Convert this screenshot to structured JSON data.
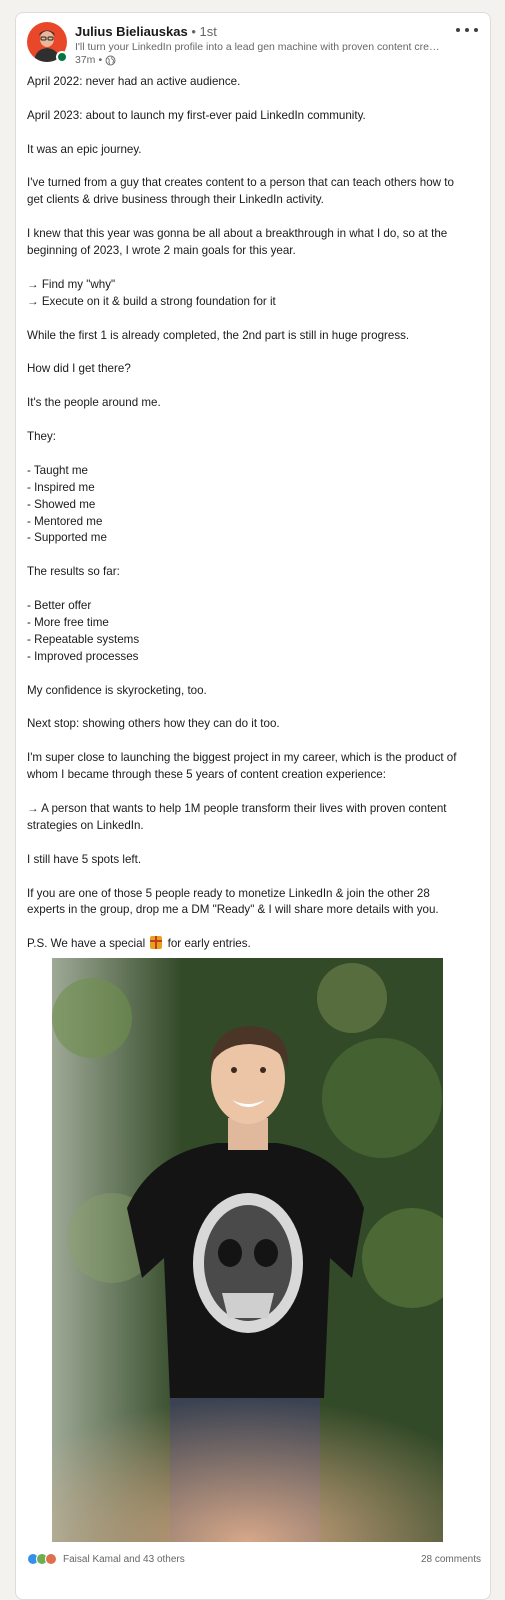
{
  "post": {
    "author": {
      "name": "Julius Bieliauskas",
      "separator": "•",
      "degree": "1st",
      "headline": "I'll turn your LinkedIn profile into a lead gen machine with proven content creati...",
      "time": "37m",
      "time_separator": "•",
      "visibility_icon": "globe-icon"
    },
    "menu_icon": "more-horizontal-icon",
    "body_lines": [
      "April 2022: never had an active audience.",
      "",
      "April 2023: about to launch my first-ever paid LinkedIn community.",
      "",
      "It was an epic journey.",
      "",
      "I've turned from a guy that creates content to a person that can teach others how to",
      "get clients & drive business through their LinkedIn activity.",
      "",
      "I knew that this year was gonna be all about a breakthrough in what I do, so at the",
      "beginning of 2023, I wrote 2 main goals for this year.",
      "",
      "→ Find my \"why\"",
      "→ Execute on it & build a strong foundation for it",
      "",
      "While the first 1 is already completed, the 2nd part is still in huge progress.",
      "",
      "How did I get there?",
      "",
      "It's the people around me.",
      "",
      "They:",
      "",
      "- Taught me",
      "- Inspired me",
      "- Showed me",
      "- Mentored me",
      "- Supported me",
      "",
      "The results so far:",
      "",
      "- Better offer",
      "- More free time",
      "- Repeatable systems",
      "- Improved processes",
      "",
      "My confidence is skyrocketing, too.",
      "",
      "Next stop: showing others how they can do it too.",
      "",
      "I'm super close to launching the biggest project in my career, which is the product of",
      "whom I became through these 5 years of content creation experience:",
      "",
      "→ A person that wants to help 1M people transform their lives with proven content",
      "strategies on LinkedIn.",
      "",
      "I still have 5 spots left.",
      "",
      "If you are one of those 5 people ready to monetize LinkedIn & join the other 28",
      "experts in the group, drop me a DM \"Ready\" & I will share more details with you.",
      ""
    ],
    "ps_before": "P.S. We have a special",
    "ps_icon": "gift-icon",
    "ps_after": "for early entries.",
    "image_icon": "post-photo",
    "reactions": {
      "icons": [
        "like-icon",
        "celebrate-icon",
        "love-icon"
      ],
      "label": "Faisal Kamal and 43 others"
    },
    "comments_label": "28 comments"
  }
}
